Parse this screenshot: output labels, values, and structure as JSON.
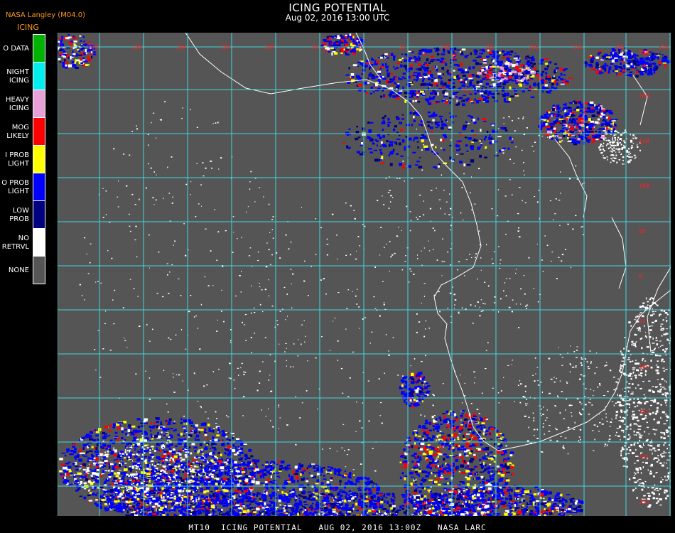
{
  "header": {
    "title": "ICING POTENTIAL",
    "subtitle": "Aug 02, 2016 13:00 UTC",
    "agency": "NASA Langley (M04.0)",
    "product": "ICING"
  },
  "legend": [
    {
      "lines": [
        "O DATA"
      ],
      "color": "#00b300"
    },
    {
      "lines": [
        "NIGHT",
        "ICING"
      ],
      "color": "#00eeee"
    },
    {
      "lines": [
        "HEAVY",
        "ICING"
      ],
      "color": "#e8a0d8"
    },
    {
      "lines": [
        "MOG",
        "LIKELY"
      ],
      "color": "#ff0000"
    },
    {
      "lines": [
        "I PROB",
        "LIGHT"
      ],
      "color": "#ffff00"
    },
    {
      "lines": [
        "O PROB",
        "LIGHT"
      ],
      "color": "#0000ff"
    },
    {
      "lines": [
        "LOW",
        "PROB"
      ],
      "color": "#000080"
    },
    {
      "lines": [
        "NO",
        "RETRVL"
      ],
      "color": "#ffffff"
    },
    {
      "lines": [
        "NONE"
      ],
      "color": "#555555"
    }
  ],
  "map": {
    "background": "#555555",
    "grid_color": "#40d8e0",
    "coastline_color": "#ffffff",
    "top_lon_labels": [
      "30W",
      "25W",
      "20W",
      "15W",
      "10W",
      "5W",
      "0",
      "5E",
      "10E",
      "15E",
      "20E",
      "25E",
      "30E",
      "35E"
    ],
    "right_lat_labels": [
      "25N",
      "20N",
      "15N",
      "10N",
      "5N",
      "0",
      "5S",
      "10S",
      "15S",
      "20S",
      "25S",
      "30S"
    ],
    "label_color": "#ff2020"
  },
  "footer": {
    "text": "MT10  ICING POTENTIAL   AUG 02, 2016 13:00Z   NASA LARC"
  }
}
